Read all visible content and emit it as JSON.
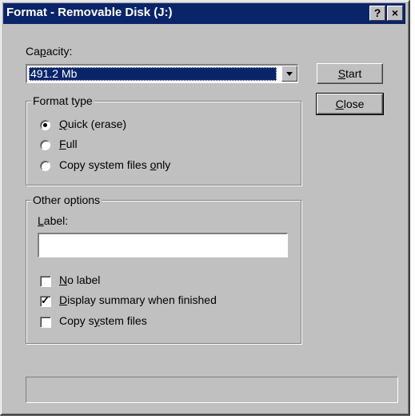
{
  "window": {
    "title": "Format - Removable Disk (J:)",
    "help_button": "?",
    "close_button": "×"
  },
  "capacity": {
    "label": "Capacity:",
    "selected_value": "491.2 Mb"
  },
  "buttons": {
    "start": "Start",
    "close": "Close"
  },
  "format_type": {
    "legend": "Format type",
    "options": [
      {
        "label": "Quick (erase)",
        "selected": true
      },
      {
        "label": "Full",
        "selected": false
      },
      {
        "label": "Copy system files only",
        "selected": false
      }
    ]
  },
  "other_options": {
    "legend": "Other options",
    "label_field_caption": "Label:",
    "label_field_value": "",
    "checkboxes": [
      {
        "label": "No label",
        "checked": false
      },
      {
        "label": "Display summary when finished",
        "checked": true
      },
      {
        "label": "Copy system files",
        "checked": false
      }
    ]
  },
  "colors": {
    "titlebar": "#0a246a",
    "face": "#c0c0c0",
    "selection": "#0a246a"
  }
}
